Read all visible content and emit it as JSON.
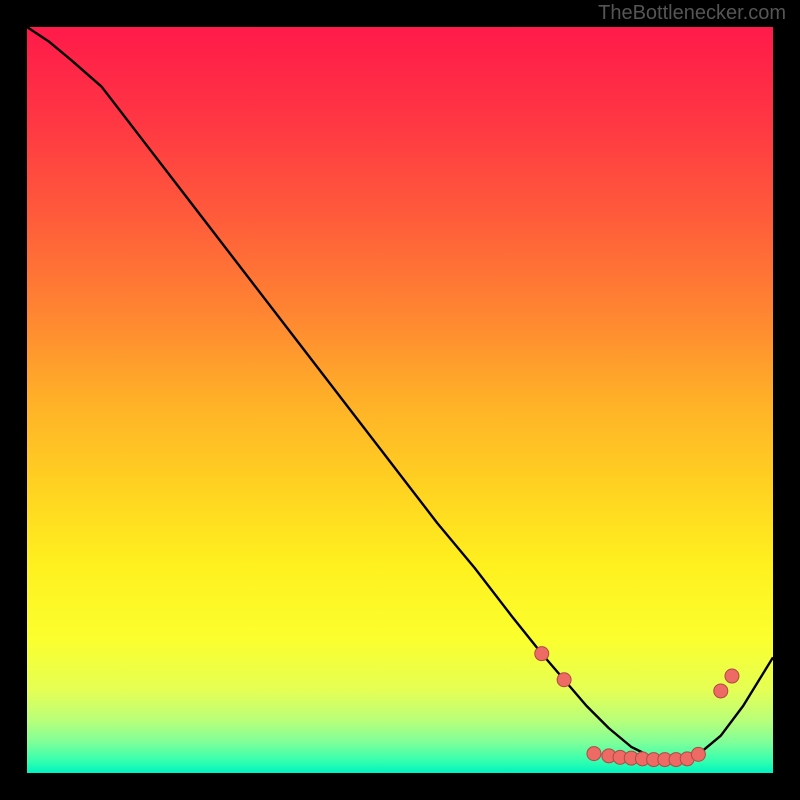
{
  "attribution": "TheBottlenecker.com",
  "chart_data": {
    "type": "line",
    "title": "",
    "xlabel": "",
    "ylabel": "",
    "xlim": [
      0,
      100
    ],
    "ylim": [
      0,
      100
    ],
    "grid": false,
    "series": [
      {
        "name": "curve",
        "x": [
          0,
          3,
          6,
          10,
          15,
          20,
          25,
          30,
          35,
          40,
          45,
          50,
          55,
          60,
          65,
          69,
          72,
          75,
          78,
          81,
          84,
          87,
          90,
          93,
          96,
          100
        ],
        "y": [
          100,
          98,
          95.5,
          92,
          85.5,
          79,
          72.5,
          66,
          59.5,
          53,
          46.5,
          40,
          33.5,
          27.5,
          21,
          16,
          12.5,
          9,
          6,
          3.5,
          2,
          1.5,
          2.5,
          5,
          9,
          15.5
        ]
      }
    ],
    "markers": [
      {
        "x": 69,
        "y": 16
      },
      {
        "x": 72,
        "y": 12.5
      },
      {
        "x": 76,
        "y": 2.6
      },
      {
        "x": 78,
        "y": 2.3
      },
      {
        "x": 79.5,
        "y": 2.1
      },
      {
        "x": 81,
        "y": 2
      },
      {
        "x": 82.5,
        "y": 1.9
      },
      {
        "x": 84,
        "y": 1.8
      },
      {
        "x": 85.5,
        "y": 1.8
      },
      {
        "x": 87,
        "y": 1.8
      },
      {
        "x": 88.5,
        "y": 1.9
      },
      {
        "x": 90,
        "y": 2.5
      },
      {
        "x": 93,
        "y": 11
      },
      {
        "x": 94.5,
        "y": 13
      }
    ],
    "background": {
      "type": "vertical-gradient",
      "stops": [
        {
          "pos": 0.0,
          "color": "#ff1a4a"
        },
        {
          "pos": 0.12,
          "color": "#ff3544"
        },
        {
          "pos": 0.25,
          "color": "#ff5a3b"
        },
        {
          "pos": 0.38,
          "color": "#ff8432"
        },
        {
          "pos": 0.5,
          "color": "#ffb028"
        },
        {
          "pos": 0.62,
          "color": "#ffd321"
        },
        {
          "pos": 0.72,
          "color": "#fff01f"
        },
        {
          "pos": 0.82,
          "color": "#fbff2d"
        },
        {
          "pos": 0.89,
          "color": "#e4ff55"
        },
        {
          "pos": 0.93,
          "color": "#b8ff7a"
        },
        {
          "pos": 0.96,
          "color": "#7cff9a"
        },
        {
          "pos": 0.985,
          "color": "#30ffb0"
        },
        {
          "pos": 1.0,
          "color": "#00f2c0"
        }
      ]
    },
    "marker_style": {
      "fill": "#ed6a65",
      "stroke": "#b14945",
      "r": 7
    }
  }
}
